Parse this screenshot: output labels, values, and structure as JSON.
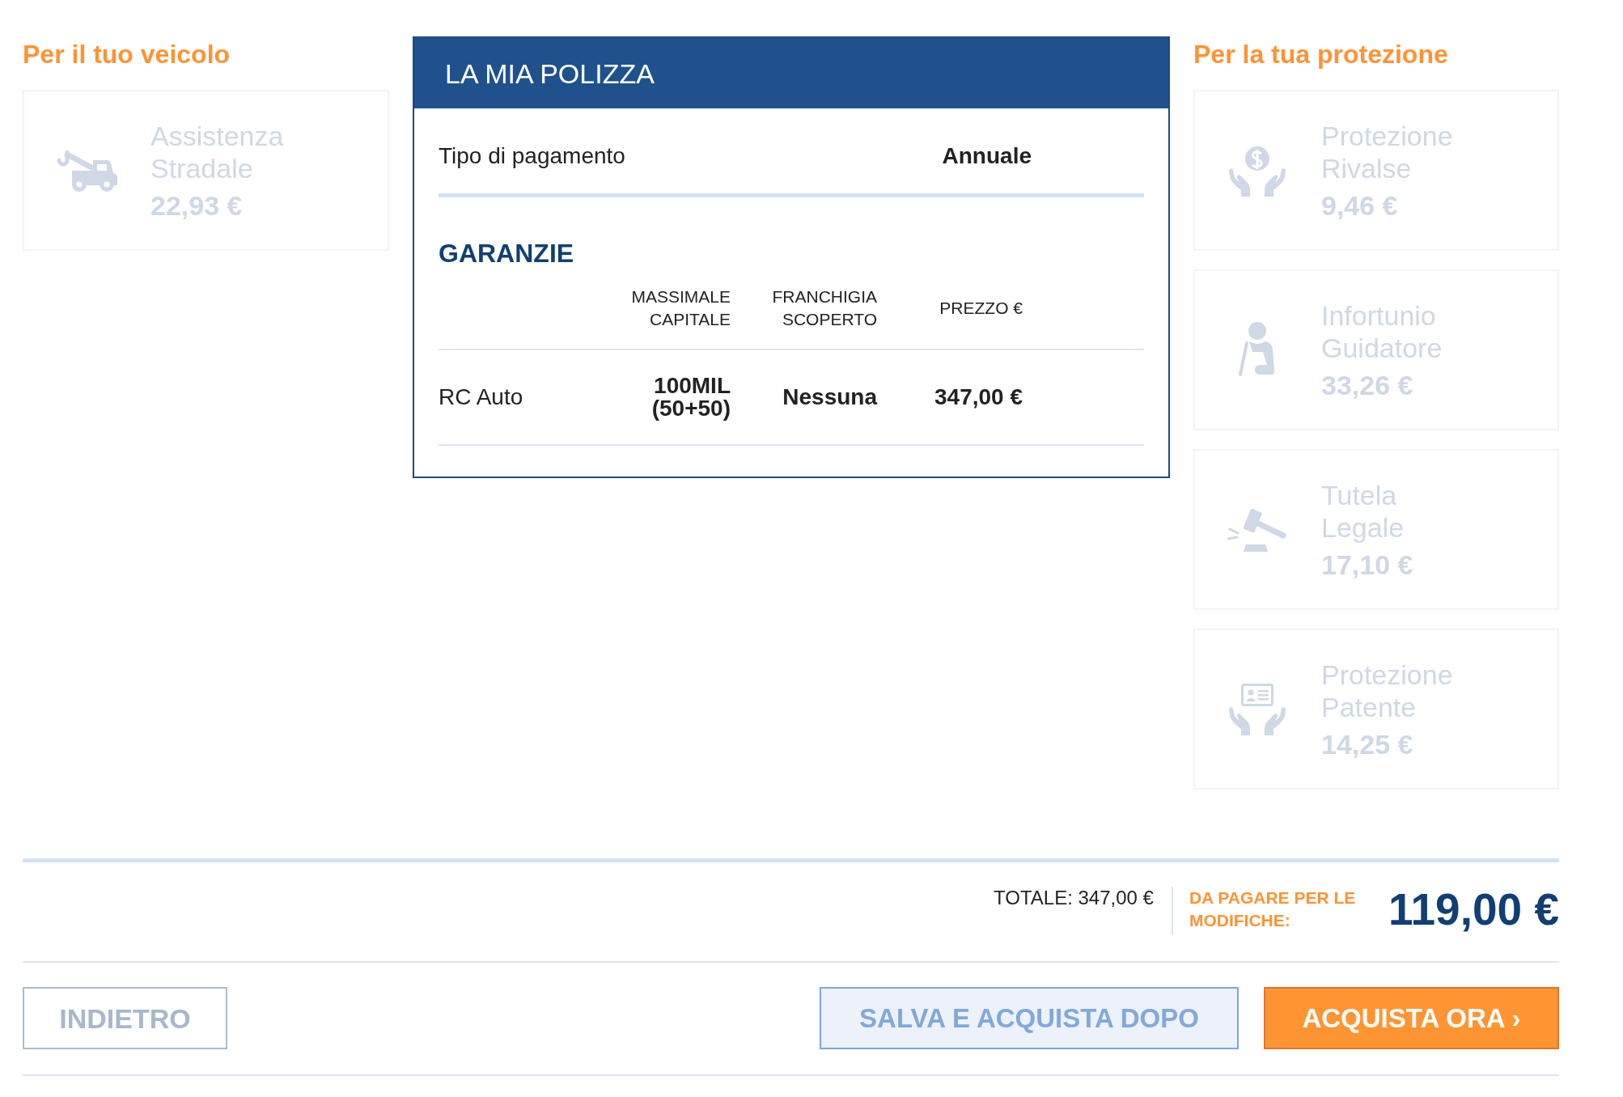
{
  "vehicle_section": {
    "title": "Per il tuo veicolo",
    "items": [
      {
        "name": "Assistenza Stradale",
        "price": "22,93 €",
        "selected": false
      }
    ]
  },
  "policy": {
    "title": "LA MIA POLIZZA",
    "payment": {
      "label": "Tipo di pagamento",
      "value": "Annuale"
    },
    "coverages": {
      "title": "GARANZIE",
      "columns": [
        "MASSIMALE CAPITALE",
        "FRANCHIGIA SCOPERTO",
        "PREZZO €"
      ],
      "rows": [
        {
          "name": "RC Auto",
          "cells": [
            "100MIL (50+50)",
            "Nessuna",
            "347,00 €"
          ]
        }
      ]
    }
  },
  "protection_section": {
    "title": "Per la tua protezione",
    "items": [
      {
        "name": "Protezione Rivalse",
        "price": "9,46 €",
        "selected": false
      },
      {
        "name": "Infortunio Guidatore",
        "price": "33,26 €",
        "selected": false
      },
      {
        "name": "Tutela Legale",
        "price": "17,10 €",
        "selected": false
      },
      {
        "name": "Protezione Patente",
        "price": "14,25 €",
        "selected": false
      }
    ]
  },
  "summary": {
    "total": "TOTALE: 347,00 €",
    "due_label": "DA PAGARE PER LE MODIFICHE:",
    "due_amount": "119,00 €"
  },
  "buttons": [
    {
      "label": "INDIETRO",
      "kind": "outline"
    },
    {
      "label": "SALVA E ACQUISTA DOPO",
      "kind": "secondary"
    },
    {
      "label": "ACQUISTA ORA ›",
      "kind": "primary"
    }
  ]
}
